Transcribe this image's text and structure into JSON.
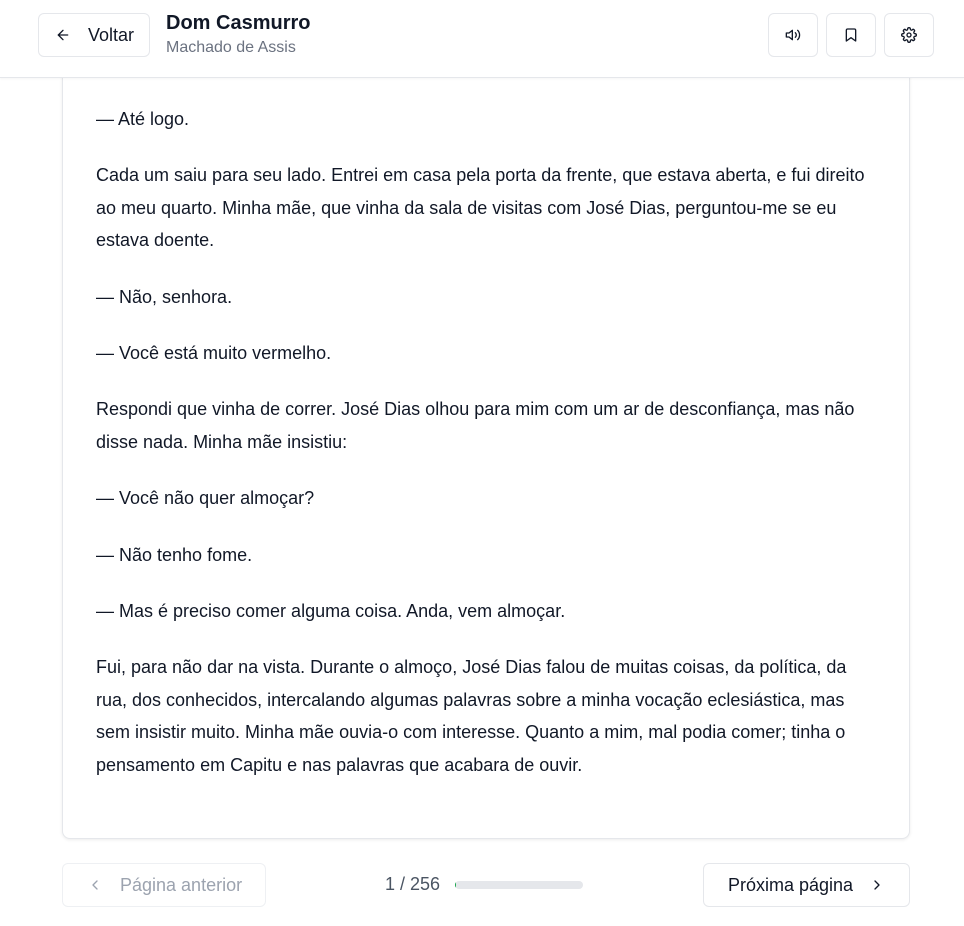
{
  "header": {
    "back_label": "Voltar",
    "title": "Dom Casmurro",
    "author": "Machado de Assis",
    "icons": [
      "arrow-left-icon",
      "volume-icon",
      "bookmark-icon",
      "gear-icon"
    ]
  },
  "content": {
    "paragraphs": [
      "— Até logo.",
      "Cada um saiu para seu lado. Entrei em casa pela porta da frente, que estava aberta, e fui direito ao meu quarto. Minha mãe, que vinha da sala de visitas com José Dias, perguntou-me se eu estava doente.",
      "— Não, senhora.",
      "— Você está muito vermelho.",
      "Respondi que vinha de correr. José Dias olhou para mim com um ar de desconfiança, mas não disse nada. Minha mãe insistiu:",
      "— Você não quer almoçar?",
      "— Não tenho fome.",
      "— Mas é preciso comer alguma coisa. Anda, vem almoçar.",
      "Fui, para não dar na vista. Durante o almoço, José Dias falou de muitas coisas, da política, da rua, dos conhecidos, intercalando algumas palavras sobre a minha vocação eclesiástica, mas sem insistir muito. Minha mãe ouvia-o com interesse. Quanto a mim, mal podia comer; tinha o pensamento em Capitu e nas palavras que acabara de ouvir."
    ]
  },
  "footer": {
    "prev_label": "Página anterior",
    "next_label": "Próxima página",
    "page_indicator": "1 / 256",
    "progress_fraction": 0.0039,
    "progress_color": "#16a34a",
    "icons": [
      "chevron-left-icon",
      "chevron-right-icon"
    ]
  }
}
